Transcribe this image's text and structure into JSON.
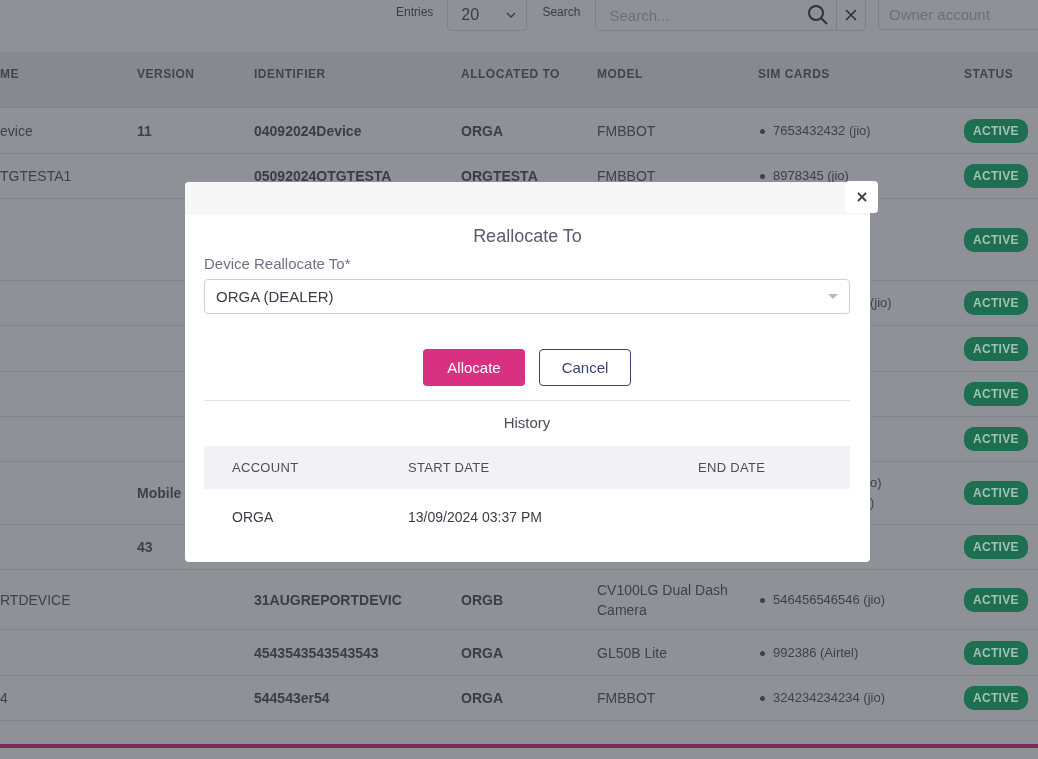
{
  "toolbar": {
    "entries_label": "Entries",
    "entries_value": "20",
    "search_label": "Search",
    "search_placeholder": "Search...",
    "owner_placeholder": "Owner account"
  },
  "table": {
    "columns": [
      "ME",
      "VERSION",
      "IDENTIFIER",
      "ALLOCATED TO",
      "MODEL",
      "SIM CARDS",
      "STATUS"
    ],
    "rows": [
      {
        "name": "evice",
        "version": "11",
        "identifier": "04092024Device",
        "allocated_to": "ORGA",
        "model": "FMBBOT",
        "sim_cards": [
          "7653432432 (jio)"
        ],
        "covered": false,
        "status": "ACTIVE"
      },
      {
        "name": "TGTESTA1",
        "version": "",
        "identifier": "05092024OTGTESTA",
        "allocated_to": "ORGTESTA",
        "model": "FMBBOT",
        "sim_cards": [
          "8978345 (jio)"
        ],
        "covered": false,
        "status": "ACTIVE"
      },
      {
        "name": "",
        "version": "",
        "identifier": "",
        "allocated_to": "",
        "model": "",
        "sim_cards": [],
        "status": "ACTIVE"
      },
      {
        "name": "",
        "version": "",
        "identifier": "",
        "allocated_to": "",
        "model": "",
        "sim_cards": [
          "(jio)"
        ],
        "covered": true,
        "status": "ACTIVE"
      },
      {
        "name": "",
        "version": "",
        "identifier": "",
        "allocated_to": "",
        "model": "",
        "sim_cards": [],
        "status": "ACTIVE"
      },
      {
        "name": "",
        "version": "",
        "identifier": "",
        "allocated_to": "",
        "model": "",
        "sim_cards": [],
        "status": "ACTIVE"
      },
      {
        "name": "",
        "version": "",
        "identifier": "",
        "allocated_to": "",
        "model": "",
        "sim_cards": [],
        "status": "ACTIVE"
      },
      {
        "name": "",
        "version": "Mobile",
        "identifier": "",
        "allocated_to": "",
        "model": "",
        "sim_cards": [
          "o)",
          ")"
        ],
        "covered": true,
        "status": "ACTIVE"
      },
      {
        "name": "",
        "version": "43",
        "identifier": "",
        "allocated_to": "",
        "model": "",
        "sim_cards": [],
        "status": "ACTIVE"
      },
      {
        "name": "RTDEVICE",
        "version": "",
        "identifier": "31AUGREPORTDEVIC",
        "allocated_to": "ORGB",
        "model": "CV100LG Dual Dash Camera",
        "sim_cards": [
          "546456546546 (jio)"
        ],
        "covered": false,
        "status": "ACTIVE"
      },
      {
        "name": "",
        "version": "",
        "identifier": "4543543543543543",
        "allocated_to": "ORGA",
        "model": "GL50B Lite",
        "sim_cards": [
          "992386 (Airtel)"
        ],
        "covered": false,
        "status": "ACTIVE"
      },
      {
        "name": "4",
        "version": "",
        "identifier": "544543er54",
        "allocated_to": "ORGA",
        "model": "FMBBOT",
        "sim_cards": [
          "324234234234 (jio)"
        ],
        "covered": false,
        "status": "ACTIVE"
      }
    ]
  },
  "modal": {
    "title": "Reallocate To",
    "field_label": "Device Reallocate To*",
    "field_value": "ORGA (DEALER)",
    "buttons": [
      {
        "label": "Allocate",
        "kind": "primary"
      },
      {
        "label": "Cancel",
        "kind": "secondary"
      }
    ],
    "history_title": "History",
    "history_columns": [
      "ACCOUNT",
      "START DATE",
      "END DATE"
    ],
    "history_rows": [
      [
        "ORGA",
        "13/09/2024 03:37 PM",
        ""
      ]
    ]
  }
}
